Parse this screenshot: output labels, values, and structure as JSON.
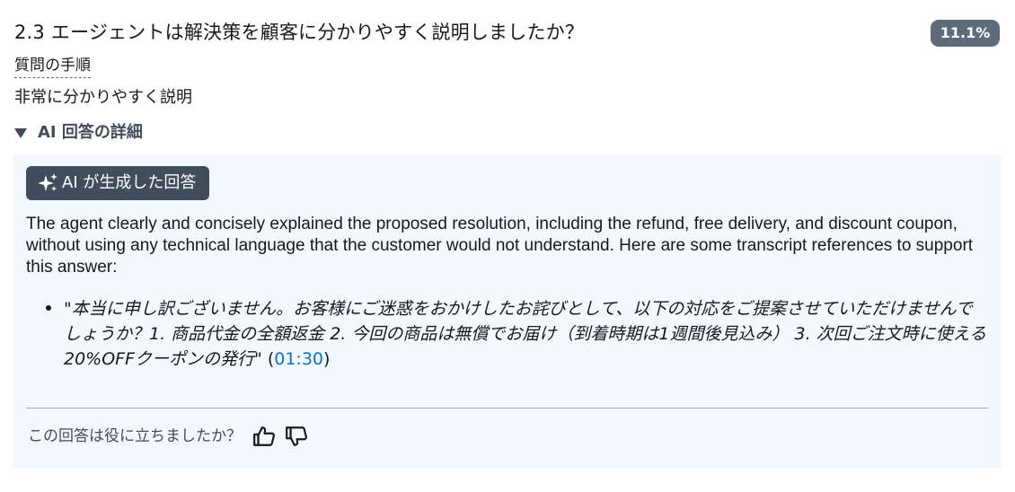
{
  "question": {
    "title": "2.3 エージェントは解決策を顧客に分かりやすく説明しましたか？",
    "score": "11.1%",
    "procedure_link": "質問の手順",
    "answer": "非常に分かりやすく説明"
  },
  "details": {
    "expander_label": "AI 回答の詳細",
    "expanded": true,
    "ai_label": "AI が生成した回答",
    "ai_icon": "sparkle-icon",
    "explanation": "The agent clearly and concisely explained the proposed resolution, including the refund, free delivery, and discount coupon, without using any technical language that the customer would not understand. Here are some transcript references to support this answer:",
    "references": [
      {
        "quote": "本当に申し訳ございません。お客様にご迷惑をおかけしたお詫びとして、以下の対応をご提案させていただけませんでしょうか？1. 商品代金の全額返金 2. 今回の商品は無償でお届け（到着時期は1週間後見込み） 3. 次回ご注文時に使える20%OFFクーポンの発行",
        "timestamp": "01:30"
      }
    ],
    "feedback_prompt": "この回答は役に立ちましたか？",
    "feedback_icons": [
      "thumbs-up-icon",
      "thumbs-down-icon"
    ]
  },
  "colors": {
    "badge": "#5f6b7a",
    "ai_label": "#414d5c",
    "panel_bg": "#f2f8fd",
    "link": "#0972d3"
  }
}
